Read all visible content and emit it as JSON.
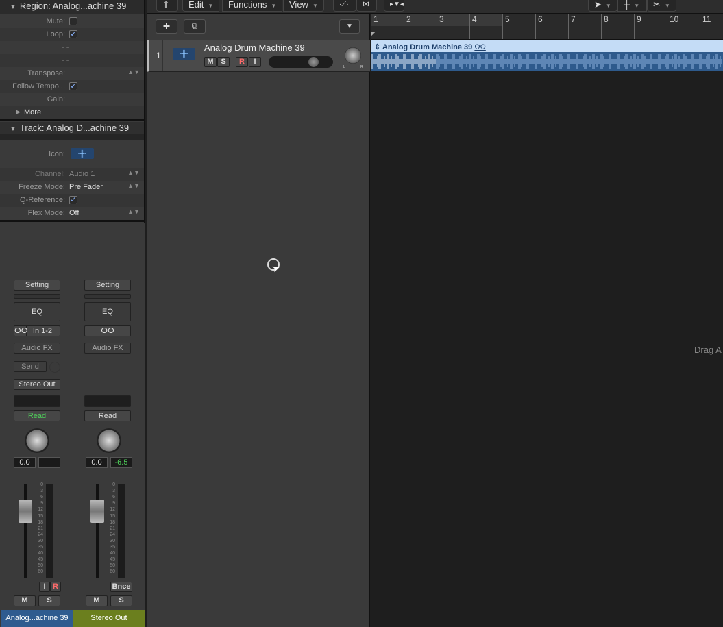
{
  "inspector": {
    "region": {
      "header": "Region: Analog...achine 39",
      "rows": [
        {
          "label": "Mute:",
          "checked": false
        },
        {
          "label": "Loop:",
          "checked": true
        },
        {
          "label": "",
          "value": "- -"
        },
        {
          "label": "",
          "value": "- -"
        },
        {
          "label": "Transpose:"
        },
        {
          "label": "Follow Tempo...",
          "checked": true
        },
        {
          "label": "Gain:"
        }
      ],
      "more": "More"
    },
    "track": {
      "header": "Track:  Analog D...achine 39",
      "icon_label": "Icon:",
      "channel_label": "Channel:",
      "channel": "Audio 1",
      "freeze_label": "Freeze Mode:",
      "freeze": "Pre Fader",
      "qref_label": "Q-Reference:",
      "qref_checked": true,
      "flex_label": "Flex Mode:",
      "flex": "Off"
    }
  },
  "toolbar": {
    "edit": "Edit",
    "functions": "Functions",
    "view": "View"
  },
  "tracks": [
    {
      "number": "1",
      "name": "Analog Drum Machine 39",
      "mute": "M",
      "solo": "S",
      "record": "R",
      "input": "I",
      "pan_labels": [
        "L",
        "R"
      ]
    }
  ],
  "ruler": {
    "bars": [
      "1",
      "2",
      "3",
      "4",
      "5",
      "6",
      "7",
      "8",
      "9",
      "10",
      "11"
    ]
  },
  "region": {
    "name": "Analog Drum Machine 39",
    "loop_icon": "ΩΩ",
    "color": "#c4dcf6",
    "wave_color": "#2e5a8c"
  },
  "drag_hint": "Drag A",
  "mixer": {
    "scale": [
      "0",
      "3",
      "6",
      "9",
      "12",
      "15",
      "18",
      "21",
      "24",
      "30",
      "35",
      "40",
      "45",
      "50",
      "60"
    ],
    "strips": [
      {
        "setting": "Setting",
        "eq": "EQ",
        "input": "In 1-2",
        "audio_fx": "Audio FX",
        "send": "Send",
        "output": "Stereo Out",
        "automation": "Read",
        "volume": "0.0",
        "peak": "",
        "input_mon": "I",
        "rec": "R",
        "mute": "M",
        "solo": "S",
        "name": "Analog...achine 39",
        "name_color": "#2f5b8f"
      },
      {
        "setting": "Setting",
        "eq": "EQ",
        "audio_fx": "Audio FX",
        "automation": "Read",
        "volume": "0.0",
        "peak": "-6.5",
        "bounce": "Bnce",
        "mute": "M",
        "solo": "S",
        "name": "Stereo Out",
        "name_color": "#6b7f1e"
      }
    ]
  }
}
